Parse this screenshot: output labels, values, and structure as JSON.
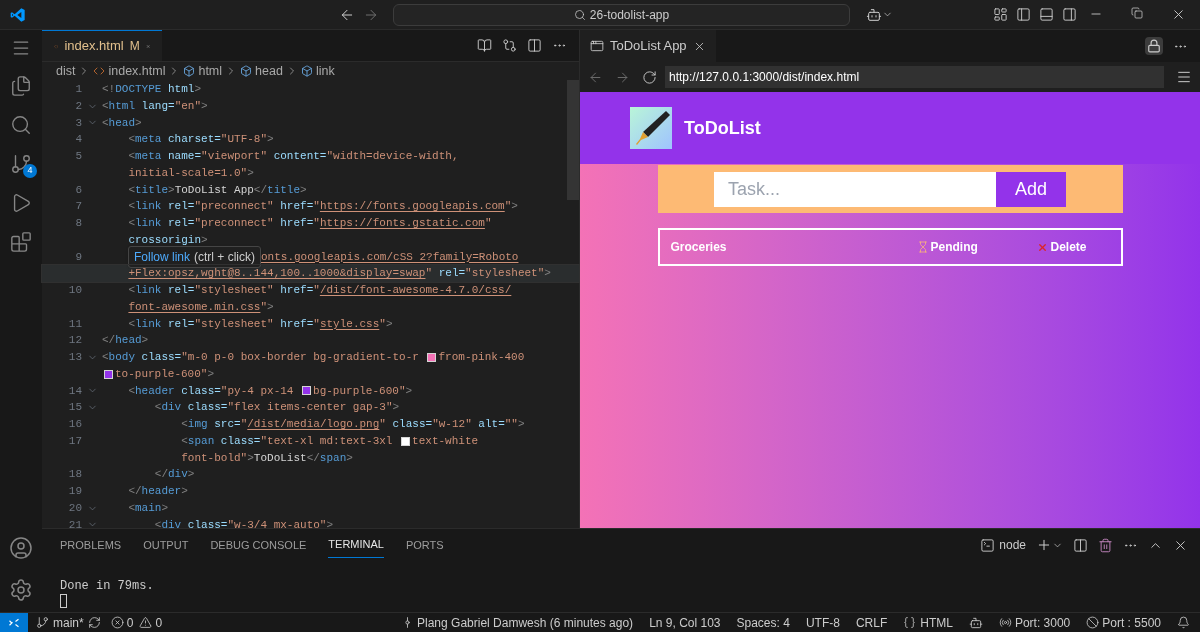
{
  "title_bar": {
    "search": "26-todolist-app"
  },
  "activity_bar": {
    "source_control_badge": "4"
  },
  "editor": {
    "tabs": [
      {
        "label": "index.html",
        "status": "M",
        "selected": true
      }
    ],
    "breadcrumbs": [
      {
        "label": "dist",
        "kind": "folder"
      },
      {
        "label": "index.html",
        "kind": "file"
      },
      {
        "label": "html",
        "kind": "element"
      },
      {
        "label": "head",
        "kind": "element"
      },
      {
        "label": "link",
        "kind": "element"
      }
    ],
    "rows": [
      {
        "number": "1",
        "fold": false,
        "current": false,
        "tokens": [
          {
            "kind": "tag",
            "text": "<!DOCTYPE"
          },
          {
            "kind": "attr",
            "text": " html"
          },
          {
            "kind": "tag",
            "text": ">"
          }
        ]
      },
      {
        "number": "2",
        "fold": true,
        "current": false,
        "tokens": [
          {
            "kind": "tag",
            "text": "<html"
          },
          {
            "kind": "attr",
            "text": " lang="
          },
          {
            "kind": "str",
            "text": "\"en\""
          },
          {
            "kind": "tag",
            "text": ">"
          }
        ]
      },
      {
        "number": "3",
        "fold": true,
        "current": false,
        "tokens": [
          {
            "kind": "tag",
            "text": "<head>"
          }
        ]
      },
      {
        "number": "4",
        "fold": false,
        "current": false,
        "tokens": [
          {
            "kind": "tag",
            "text": "    <meta"
          },
          {
            "kind": "attr",
            "text": " charset="
          },
          {
            "kind": "str",
            "text": "\"UTF-8\""
          },
          {
            "kind": "tag",
            "text": ">"
          }
        ]
      },
      {
        "number": "5",
        "fold": false,
        "current": false,
        "tokens": [
          {
            "kind": "tag",
            "text": "    <meta"
          },
          {
            "kind": "attr",
            "text": " name="
          },
          {
            "kind": "str",
            "text": "\"viewport\""
          },
          {
            "kind": "attr",
            "text": " content="
          },
          {
            "kind": "str",
            "text": "\"width=device-width,"
          }
        ]
      },
      {
        "fold": false,
        "current": false,
        "tokens": [
          {
            "kind": "str",
            "text": "    initial-scale=1.0\""
          },
          {
            "kind": "tag",
            "text": ">"
          }
        ]
      },
      {
        "number": "6",
        "fold": false,
        "current": false,
        "tokens": [
          {
            "kind": "tag",
            "text": "    <title>"
          },
          {
            "kind": "text",
            "text": "ToDoList App"
          },
          {
            "kind": "tag",
            "text": "</title>"
          }
        ]
      },
      {
        "number": "7",
        "fold": false,
        "current": false,
        "tokens": [
          {
            "kind": "tag",
            "text": "    <link"
          },
          {
            "kind": "attr",
            "text": " rel="
          },
          {
            "kind": "str",
            "text": "\"preconnect\""
          },
          {
            "kind": "attr",
            "text": " href="
          },
          {
            "kind": "str",
            "text": "\""
          },
          {
            "kind": "url",
            "text": "https://fonts.googleapis.com"
          },
          {
            "kind": "str",
            "text": "\""
          },
          {
            "kind": "tag",
            "text": ">"
          }
        ]
      },
      {
        "number": "8",
        "fold": false,
        "current": false,
        "tokens": [
          {
            "kind": "tag",
            "text": "    <link"
          },
          {
            "kind": "attr",
            "text": " rel="
          },
          {
            "kind": "str",
            "text": "\"preconnect\""
          },
          {
            "kind": "attr",
            "text": " href="
          },
          {
            "kind": "str",
            "text": "\""
          },
          {
            "kind": "url",
            "text": "https://fonts.gstatic.com"
          },
          {
            "kind": "str",
            "text": "\""
          }
        ]
      },
      {
        "fold": false,
        "current": false,
        "tokens": [
          {
            "kind": "attr",
            "text": "    crossorigin"
          },
          {
            "kind": "tag",
            "text": ">"
          }
        ]
      },
      {
        "number": "9",
        "fold": false,
        "current": false,
        "tokens": [
          {
            "kind": "tooltip",
            "link": "Follow link",
            "hint": "(ctrl + click)"
          },
          {
            "kind": "url",
            "text": "onts.googleapis.com/cSS 2?family=Roboto"
          }
        ]
      },
      {
        "fold": false,
        "current": true,
        "tokens": [
          {
            "kind": "url",
            "text": "    +Flex:opsz,wght@8..144,100..1000&display=swap"
          },
          {
            "kind": "str",
            "text": "\""
          },
          {
            "kind": "attr",
            "text": " rel="
          },
          {
            "kind": "str",
            "text": "\"stylesheet\""
          },
          {
            "kind": "tag",
            "text": ">"
          }
        ]
      },
      {
        "number": "10",
        "fold": false,
        "current": false,
        "tokens": [
          {
            "kind": "tag",
            "text": "    <link"
          },
          {
            "kind": "attr",
            "text": " rel="
          },
          {
            "kind": "str",
            "text": "\"stylesheet\""
          },
          {
            "kind": "attr",
            "text": " href="
          },
          {
            "kind": "str",
            "text": "\""
          },
          {
            "kind": "url",
            "text": "/dist/font-awesome-4.7.0/css/"
          }
        ]
      },
      {
        "fold": false,
        "current": false,
        "tokens": [
          {
            "kind": "url",
            "text": "    font-awesome.min.css"
          },
          {
            "kind": "str",
            "text": "\""
          },
          {
            "kind": "tag",
            "text": ">"
          }
        ]
      },
      {
        "number": "11",
        "fold": false,
        "current": false,
        "tokens": [
          {
            "kind": "tag",
            "text": "    <link"
          },
          {
            "kind": "attr",
            "text": " rel="
          },
          {
            "kind": "str",
            "text": "\"stylesheet\""
          },
          {
            "kind": "attr",
            "text": " href="
          },
          {
            "kind": "str",
            "text": "\""
          },
          {
            "kind": "url",
            "text": "style.css"
          },
          {
            "kind": "str",
            "text": "\""
          },
          {
            "kind": "tag",
            "text": ">"
          }
        ]
      },
      {
        "number": "12",
        "fold": false,
        "current": false,
        "tokens": [
          {
            "kind": "tag",
            "text": "</head>"
          }
        ]
      },
      {
        "number": "13",
        "fold": true,
        "current": false,
        "tokens": [
          {
            "kind": "tag",
            "text": "<body"
          },
          {
            "kind": "attr",
            "text": " class="
          },
          {
            "kind": "str",
            "text": "\"m-0 p-0 box-border bg-gradient-to-r "
          },
          {
            "kind": "swatch",
            "color": "#f472b6"
          },
          {
            "kind": "str",
            "text": "from-pink-400"
          }
        ]
      },
      {
        "fold": false,
        "current": false,
        "tokens": [
          {
            "kind": "swatch",
            "color": "#9333ea"
          },
          {
            "kind": "str",
            "text": "to-purple-600\""
          },
          {
            "kind": "tag",
            "text": ">"
          }
        ]
      },
      {
        "number": "14",
        "fold": true,
        "current": false,
        "tokens": [
          {
            "kind": "tag",
            "text": "    <header"
          },
          {
            "kind": "attr",
            "text": " class="
          },
          {
            "kind": "str",
            "text": "\"py-4 px-14 "
          },
          {
            "kind": "swatch",
            "color": "#9333ea"
          },
          {
            "kind": "str",
            "text": "bg-purple-600\""
          },
          {
            "kind": "tag",
            "text": ">"
          }
        ]
      },
      {
        "number": "15",
        "fold": true,
        "current": false,
        "tokens": [
          {
            "kind": "tag",
            "text": "        <div"
          },
          {
            "kind": "attr",
            "text": " class="
          },
          {
            "kind": "str",
            "text": "\"flex items-center gap-3\""
          },
          {
            "kind": "tag",
            "text": ">"
          }
        ]
      },
      {
        "number": "16",
        "fold": false,
        "current": false,
        "tokens": [
          {
            "kind": "tag",
            "text": "            <img"
          },
          {
            "kind": "attr",
            "text": " src="
          },
          {
            "kind": "str",
            "text": "\""
          },
          {
            "kind": "url",
            "text": "/dist/media/logo.png"
          },
          {
            "kind": "str",
            "text": "\""
          },
          {
            "kind": "attr",
            "text": " class="
          },
          {
            "kind": "str",
            "text": "\"w-12\""
          },
          {
            "kind": "attr",
            "text": " alt="
          },
          {
            "kind": "str",
            "text": "\"\""
          },
          {
            "kind": "tag",
            "text": ">"
          }
        ]
      },
      {
        "number": "17",
        "fold": false,
        "current": false,
        "tokens": [
          {
            "kind": "tag",
            "text": "            <span"
          },
          {
            "kind": "attr",
            "text": " class="
          },
          {
            "kind": "str",
            "text": "\"text-xl md:text-3xl "
          },
          {
            "kind": "swatch",
            "color": "#ffffff"
          },
          {
            "kind": "str",
            "text": "text-white"
          }
        ]
      },
      {
        "fold": false,
        "current": false,
        "tokens": [
          {
            "kind": "str",
            "text": "            font-bold\""
          },
          {
            "kind": "tag",
            "text": ">"
          },
          {
            "kind": "text",
            "text": "ToDoList"
          },
          {
            "kind": "tag",
            "text": "</span>"
          }
        ]
      },
      {
        "number": "18",
        "fold": false,
        "current": false,
        "tokens": [
          {
            "kind": "tag",
            "text": "        </div>"
          }
        ]
      },
      {
        "number": "19",
        "fold": false,
        "current": false,
        "tokens": [
          {
            "kind": "tag",
            "text": "    </header>"
          }
        ]
      },
      {
        "number": "20",
        "fold": true,
        "current": false,
        "tokens": [
          {
            "kind": "tag",
            "text": "    <main>"
          }
        ]
      },
      {
        "number": "21",
        "fold": true,
        "current": false,
        "tokens": [
          {
            "kind": "tag",
            "text": "        <div"
          },
          {
            "kind": "attr",
            "text": " class="
          },
          {
            "kind": "str",
            "text": "\"w-3/4 mx-auto\""
          },
          {
            "kind": "tag",
            "text": ">"
          }
        ]
      }
    ]
  },
  "browser": {
    "tabs": [
      {
        "label": "ToDoList App",
        "selected": true
      }
    ],
    "url": "http://127.0.0.1:3000/dist/index.html",
    "page": {
      "title": "ToDoList",
      "input_placeholder": "Task...",
      "add_button": "Add",
      "tasks": [
        {
          "name": "Groceries",
          "status": "Pending",
          "action": "Delete"
        }
      ]
    }
  },
  "panel": {
    "tabs": [
      {
        "label": "PROBLEMS",
        "selected": false
      },
      {
        "label": "OUTPUT",
        "selected": false
      },
      {
        "label": "DEBUG CONSOLE",
        "selected": false
      },
      {
        "label": "TERMINAL",
        "selected": true
      },
      {
        "label": "PORTS",
        "selected": false
      }
    ],
    "terminal_name": "node",
    "terminal_lines": [
      "Done in 79ms."
    ]
  },
  "status_bar": {
    "branch": "main*",
    "errors": "0",
    "warnings": "0",
    "blame": "Plang Gabriel Damwesh (6 minutes ago)",
    "position": "Ln 9, Col 103",
    "spaces": "Spaces: 4",
    "encoding": "UTF-8",
    "eol": "CRLF",
    "language": "HTML",
    "ports": [
      {
        "label": "Port: 3000",
        "kind": "broadcast"
      },
      {
        "label": "Port : 5500",
        "kind": "blocked"
      }
    ]
  }
}
